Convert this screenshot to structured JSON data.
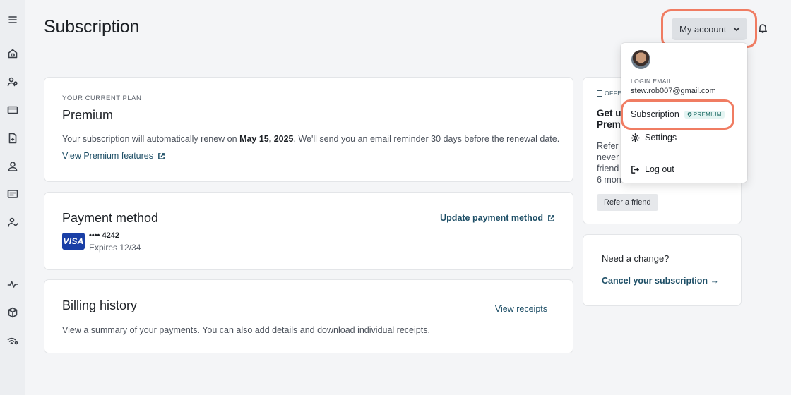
{
  "page": {
    "title": "Subscription"
  },
  "header": {
    "account_label": "My account"
  },
  "plan": {
    "overline": "YOUR CURRENT PLAN",
    "name": "Premium",
    "renew_prefix": "Your subscription will automatically renew on ",
    "renew_date": "May 15, 2025",
    "renew_suffix": ". We'll send you an email reminder 30 days before the renewal date.",
    "features_link": "View Premium features"
  },
  "payment": {
    "title": "Payment method",
    "update_link": "Update payment method",
    "card_brand": "VISA",
    "card_number": "•••• 4242",
    "card_expiry": "Expires 12/34"
  },
  "billing": {
    "title": "Billing history",
    "receipts_link": "View receipts",
    "description": "View a summary of your payments. You can also add details and download individual receipts."
  },
  "offer": {
    "badge": "OFFER",
    "heading_line1": "Get u",
    "heading_line2": "Premi",
    "body_line1": "Refer",
    "body_line2": "never",
    "body_line3": "friend",
    "body_line4": "6 mon",
    "button": "Refer a friend"
  },
  "change": {
    "title": "Need a change?",
    "cancel_link": "Cancel your subscription →"
  },
  "menu": {
    "login_label": "LOGIN EMAIL",
    "login_email": "stew.rob007@gmail.com",
    "subscription": "Subscription",
    "premium_badge": "PREMIUM",
    "settings": "Settings",
    "logout": "Log out"
  },
  "colors": {
    "accent_link": "#1d4e66",
    "highlight_ring": "#f07c62",
    "visa_blue": "#1a3fa6"
  }
}
